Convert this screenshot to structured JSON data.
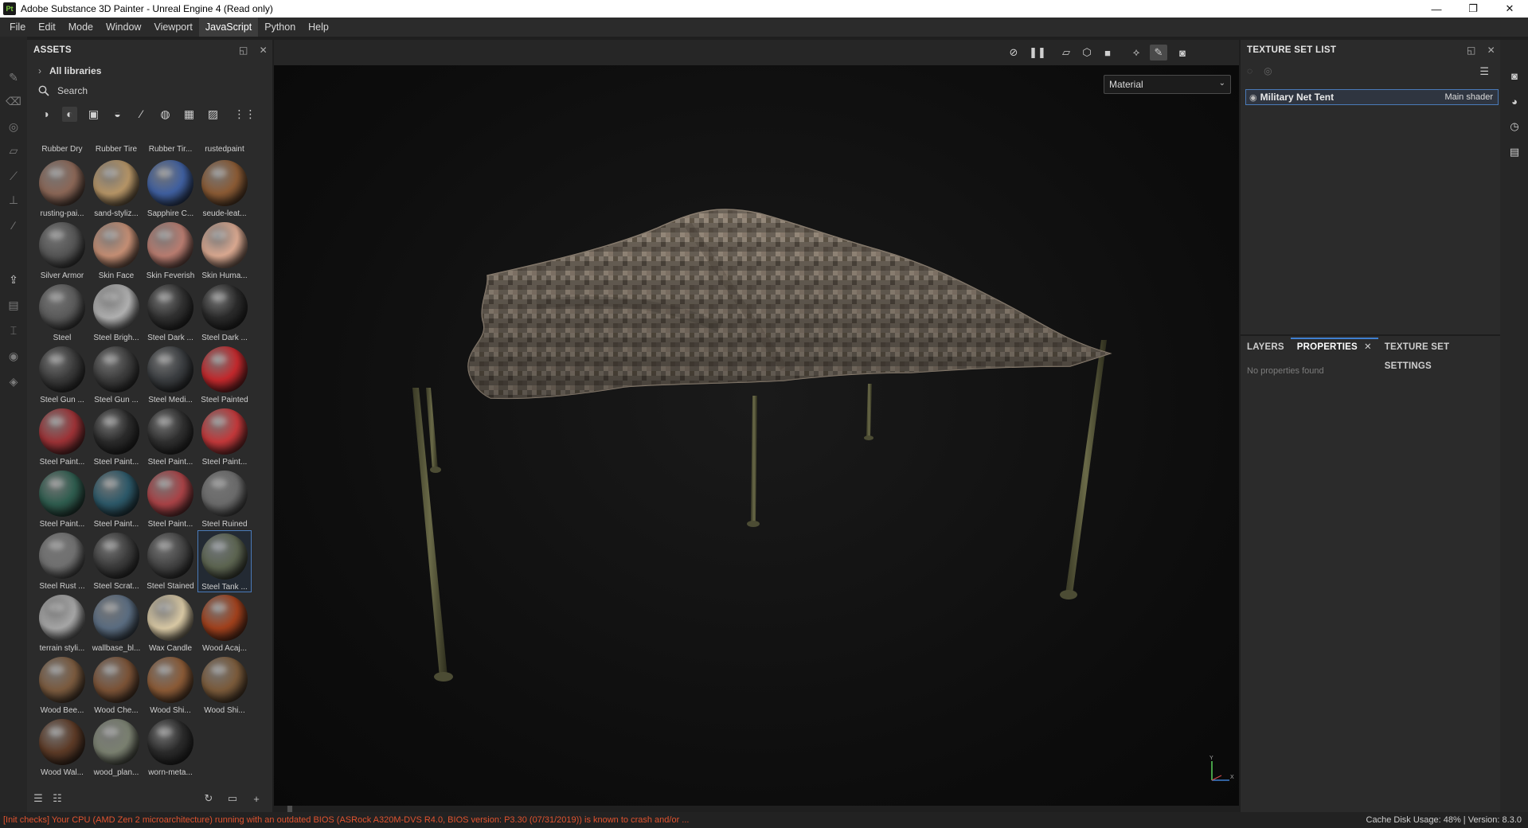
{
  "window": {
    "title": "Adobe Substance 3D Painter - Unreal Engine 4 (Read only)",
    "app_icon": "Pt",
    "controls": [
      "—",
      "❐",
      "✕"
    ]
  },
  "menu": [
    "File",
    "Edit",
    "Mode",
    "Window",
    "Viewport",
    "JavaScript",
    "Python",
    "Help"
  ],
  "menu_active": "JavaScript",
  "assets": {
    "title": "ASSETS",
    "libraries": "All libraries",
    "search_placeholder": "Search",
    "top_row_labels": [
      "Rubber Dry",
      "Rubber Tire",
      "Rubber Tir...",
      "rustedpaint"
    ],
    "items": [
      {
        "label": "rusting-pai...",
        "color": "#8a6656"
      },
      {
        "label": "sand-styliz...",
        "color": "#b59466"
      },
      {
        "label": "Sapphire C...",
        "color": "#3f5f9f"
      },
      {
        "label": "seude-leat...",
        "color": "#8a5a34"
      },
      {
        "label": "Silver Armor",
        "color": "#555555"
      },
      {
        "label": "Skin Face",
        "color": "#c48e74"
      },
      {
        "label": "Skin Feverish",
        "color": "#b87c70"
      },
      {
        "label": "Skin Huma...",
        "color": "#d9a890"
      },
      {
        "label": "Steel",
        "color": "#5a5a5a"
      },
      {
        "label": "Steel Brigh...",
        "color": "#b0b0b0"
      },
      {
        "label": "Steel Dark ...",
        "color": "#303030"
      },
      {
        "label": "Steel Dark ...",
        "color": "#2a2a2a"
      },
      {
        "label": "Steel Gun ...",
        "color": "#3a3a3a"
      },
      {
        "label": "Steel Gun ...",
        "color": "#3c3c3c"
      },
      {
        "label": "Steel Medi...",
        "color": "#3a3d40"
      },
      {
        "label": "Steel Painted",
        "color": "#c2282c"
      },
      {
        "label": "Steel Paint...",
        "color": "#9c3236"
      },
      {
        "label": "Steel Paint...",
        "color": "#2a2a2a"
      },
      {
        "label": "Steel Paint...",
        "color": "#2f2f2f"
      },
      {
        "label": "Steel Paint...",
        "color": "#c2383a"
      },
      {
        "label": "Steel Paint...",
        "color": "#2e5c4e"
      },
      {
        "label": "Steel Paint...",
        "color": "#2c5868"
      },
      {
        "label": "Steel Paint...",
        "color": "#a84246"
      },
      {
        "label": "Steel Ruined",
        "color": "#6a6a6a"
      },
      {
        "label": "Steel Rust ...",
        "color": "#707070"
      },
      {
        "label": "Steel Scrat...",
        "color": "#3c3c3c"
      },
      {
        "label": "Steel Stained",
        "color": "#444444"
      },
      {
        "label": "Steel Tank ...",
        "color": "#5c6450"
      },
      {
        "label": "terrain styli...",
        "color": "#a6a6a6"
      },
      {
        "label": "wallbase_bl...",
        "color": "#5a6c80"
      },
      {
        "label": "Wax Candle",
        "color": "#d8c8a4"
      },
      {
        "label": "Wood Acaj...",
        "color": "#a0401c"
      },
      {
        "label": "Wood Bee...",
        "color": "#7a5a3e"
      },
      {
        "label": "Wood Che...",
        "color": "#7a5236"
      },
      {
        "label": "Wood Shi...",
        "color": "#8a5a36"
      },
      {
        "label": "Wood Shi...",
        "color": "#7a5a3a"
      },
      {
        "label": "Wood Wal...",
        "color": "#5c3a26"
      },
      {
        "label": "wood_plan...",
        "color": "#7a8070"
      },
      {
        "label": "worn-meta...",
        "color": "#2a2a2a"
      }
    ],
    "selected_index": 27
  },
  "viewport": {
    "channel_select": "Material",
    "axis_labels": {
      "y": "Y",
      "x": "X"
    }
  },
  "texture_set_list": {
    "title": "TEXTURE SET LIST",
    "item_name": "Military Net Tent",
    "item_shader": "Main shader"
  },
  "properties": {
    "tabs": [
      "LAYERS",
      "PROPERTIES",
      "TEXTURE SET SETTINGS"
    ],
    "active_tab": "PROPERTIES",
    "empty_text": "No properties found"
  },
  "status": {
    "warning": "[Init checks] Your CPU (AMD Zen 2 microarchitecture) running with an outdated BIOS (ASRock A320M-DVS R4.0, BIOS version: P3.30 (07/31/2019)) is known to crash and/or ...",
    "right": "Cache Disk Usage:   48% | Version: 8.3.0"
  },
  "colors": {
    "accent": "#3f7fd0",
    "warning": "#e0532f",
    "panel": "#2b2b2b"
  }
}
